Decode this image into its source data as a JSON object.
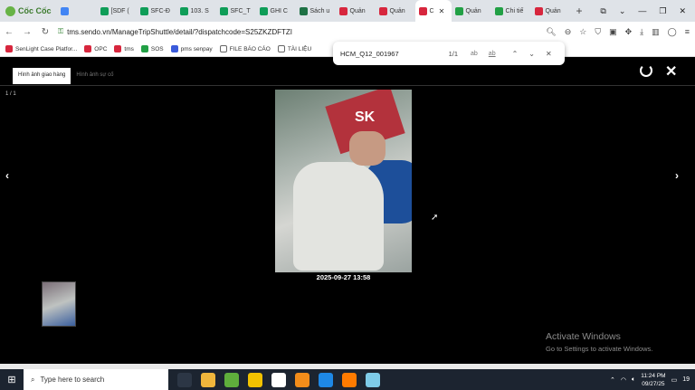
{
  "browser": {
    "brand": "Cốc Cốc",
    "tabs": [
      {
        "label": "",
        "color": "#4285f4"
      },
      {
        "label": "[SDF (",
        "color": "#0f9d58"
      },
      {
        "label": "SFC-Đ",
        "color": "#0f9d58"
      },
      {
        "label": "103. S",
        "color": "#0f9d58"
      },
      {
        "label": "SFC_T",
        "color": "#0f9d58"
      },
      {
        "label": "GHI C",
        "color": "#0f9d58"
      },
      {
        "label": "Sách u",
        "color": "#1e7145"
      },
      {
        "label": "Quản",
        "color": "#d7263d"
      },
      {
        "label": "Quản",
        "color": "#d7263d"
      },
      {
        "label": "C",
        "color": "#d7263d",
        "active": true
      },
      {
        "label": "Quản",
        "color": "#22a045"
      },
      {
        "label": "Chi tiế",
        "color": "#22a045"
      },
      {
        "label": "Quản",
        "color": "#d7263d"
      }
    ],
    "new_tab": "+",
    "url": "tms.sendo.vn/ManageTripShuttle/detail/?dispatchcode=S25ZKZDFTZI",
    "bookmarks": [
      {
        "label": "SenLight Case Platfor...",
        "color": "#d7263d"
      },
      {
        "label": "OPC",
        "color": "#d7263d"
      },
      {
        "label": "tms",
        "color": "#d7263d"
      },
      {
        "label": "SOS",
        "color": "#22a045"
      },
      {
        "label": "pms senpay",
        "color": "#3b5bdb"
      },
      {
        "label": "FILE BÁO CÁO",
        "color": "#ffffff"
      },
      {
        "label": "TÀI LIỆU",
        "color": "#ffffff"
      }
    ]
  },
  "find": {
    "query": "HCM_Q12_001967",
    "count": "1/1",
    "opt_case": "ab",
    "opt_word": "ab"
  },
  "viewer": {
    "tab_delivery": "Hình ảnh giao hàng",
    "tab_incident": "Hình ảnh sự cố",
    "counter": "1 / 1",
    "photo_sign_text": "SK",
    "timestamp": "2025-09-27 13:58",
    "prev_glyph": "‹",
    "next_glyph": "›",
    "close_glyph": "✕"
  },
  "watermark": {
    "title": "Activate Windows",
    "subtitle": "Go to Settings to activate Windows."
  },
  "taskbar": {
    "search_placeholder": "Type here to search",
    "time": "11:24 PM",
    "date": "09/27/25",
    "notif_count": "19"
  }
}
